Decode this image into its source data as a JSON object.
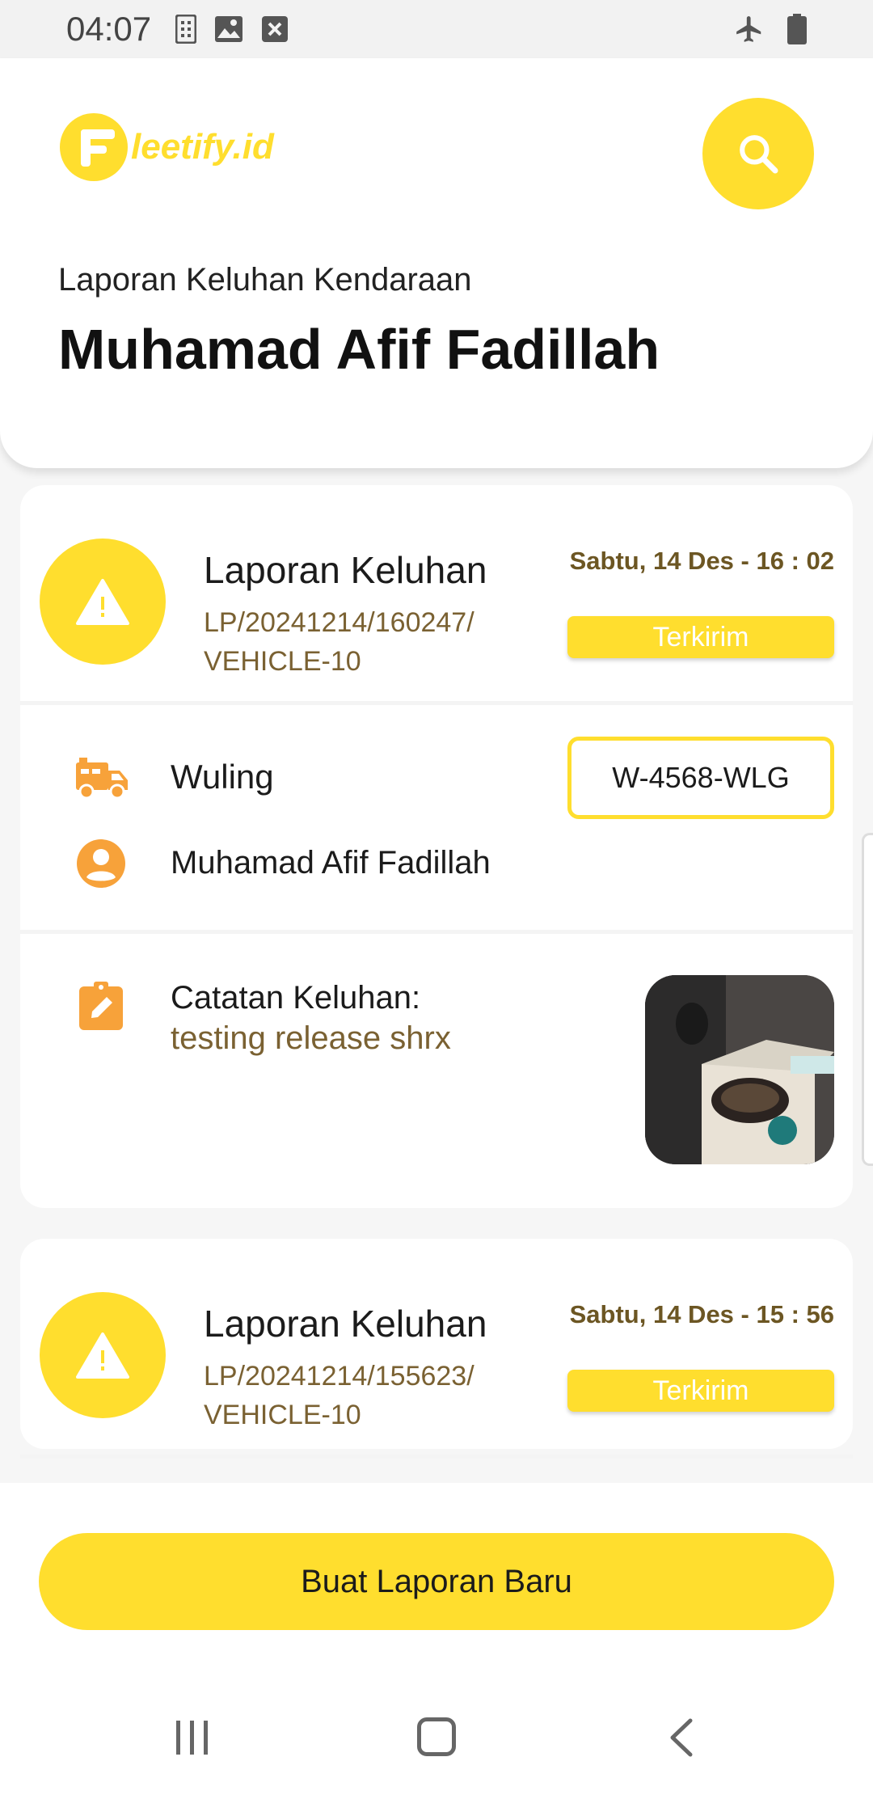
{
  "status_bar": {
    "time": "04:07",
    "icons": [
      "sim-icon",
      "image-icon",
      "close-box-icon",
      "airplane-icon",
      "battery-icon"
    ]
  },
  "header": {
    "logo_text": "leetify.id",
    "subtitle": "Laporan Keluhan Kendaraan",
    "title": "Muhamad Afif Fadillah"
  },
  "reports": [
    {
      "title": "Laporan Keluhan",
      "code_line1": "LP/20241214/160247/",
      "code_line2": "VEHICLE-10",
      "date": "Sabtu, 14 Des - 16 : 02",
      "status": "Terkirim",
      "vehicle": "Wuling",
      "plate": "W-4568-WLG",
      "driver": "Muhamad Afif Fadillah",
      "note_label": "Catatan Keluhan:",
      "note_text": "testing release shrx"
    },
    {
      "title": "Laporan Keluhan",
      "code_line1": "LP/20241214/155623/",
      "code_line2": "VEHICLE-10",
      "date": "Sabtu, 14 Des - 15 : 56",
      "status": "Terkirim"
    }
  ],
  "actions": {
    "new_report_label": "Buat Laporan Baru"
  },
  "colors": {
    "accent": "#FFDE2E",
    "icon_orange": "#F7A23A",
    "secondary_text": "#7a6132"
  }
}
